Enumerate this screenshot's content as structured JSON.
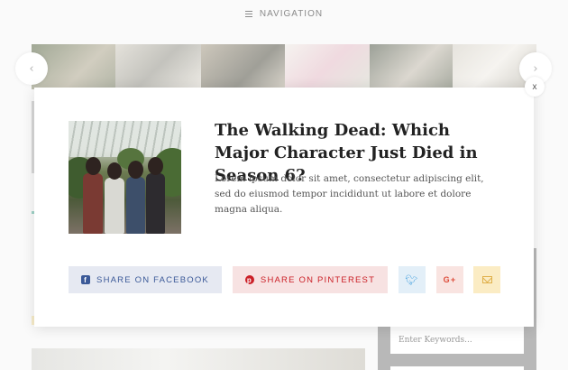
{
  "nav": {
    "label": "NAVIGATION"
  },
  "slider": {
    "prev_icon": "chevron-left-icon",
    "next_icon": "chevron-right-icon"
  },
  "sidebar": {
    "search_placeholder": "Enter Keywords..."
  },
  "modal": {
    "close_label": "x",
    "title": "The Walking Dead: Which Major Character Just Died in Season 6?",
    "excerpt": "Lorem ipsum dolor sit amet, consectetur adipiscing elit, sed do eiusmod tempor incididunt ut labore et dolore magna aliqua.",
    "share": {
      "facebook_label": "SHARE ON FACEBOOK",
      "pinterest_label": "SHARE ON PINTEREST",
      "twitter_icon": "twitter-icon",
      "googleplus_label": "G+",
      "email_icon": "mail-icon"
    }
  },
  "colors": {
    "facebook": "#3b5998",
    "pinterest": "#cb2027",
    "twitter": "#4aa3df",
    "googleplus": "#dd4b39",
    "email": "#e0b04a"
  }
}
